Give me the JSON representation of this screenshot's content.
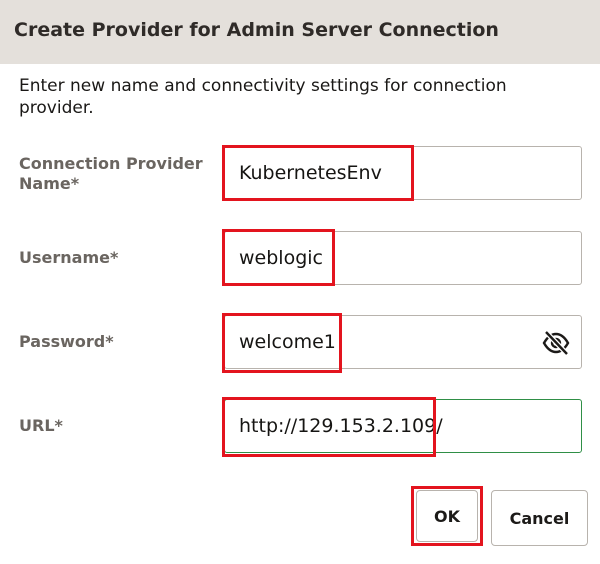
{
  "dialog": {
    "title": "Create Provider for Admin Server Connection",
    "intro": "Enter new name and connectivity settings for connection provider."
  },
  "fields": {
    "provider_name": {
      "label": "Connection Provider Name*",
      "value": "KubernetesEnv"
    },
    "username": {
      "label": "Username*",
      "value": "weblogic"
    },
    "password": {
      "label": "Password*",
      "value": "welcome1"
    },
    "url": {
      "label": "URL*",
      "value": "http://129.153.2.109/"
    }
  },
  "icons": {
    "password_toggle": "eye-slash-icon"
  },
  "buttons": {
    "ok": "OK",
    "cancel": "Cancel"
  },
  "colors": {
    "titlebar_bg": "#e4e0db",
    "highlight": "#e3141e",
    "focus_border": "#2f8f46"
  }
}
